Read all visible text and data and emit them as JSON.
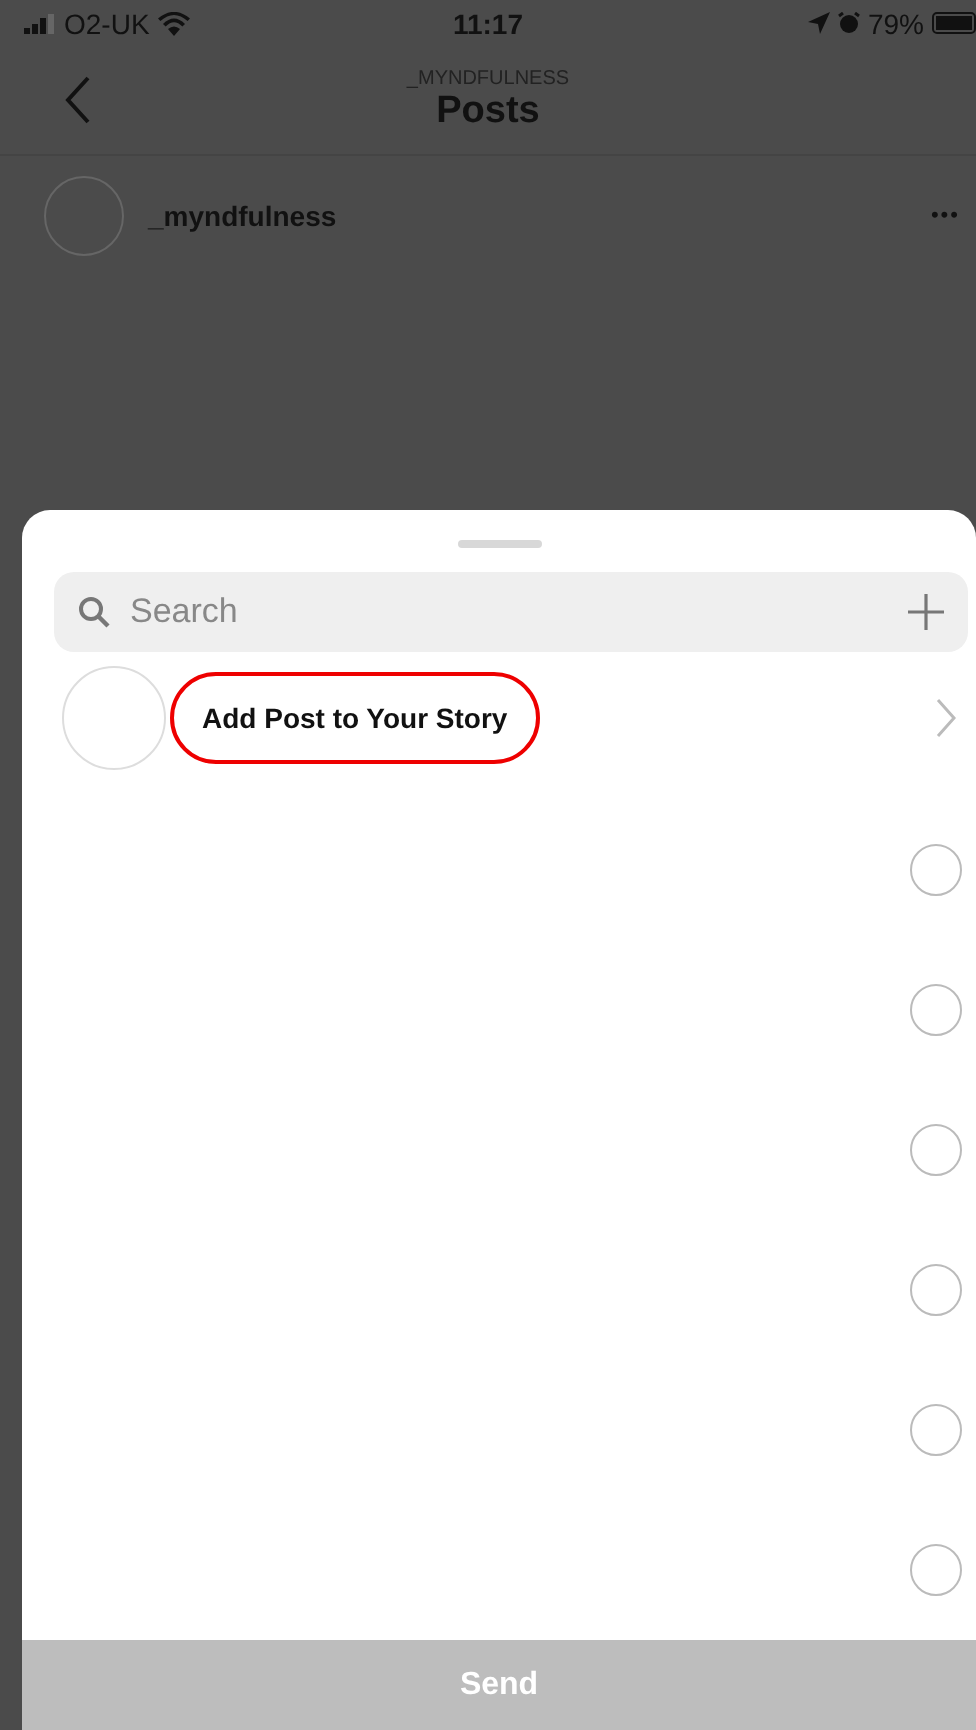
{
  "status_bar": {
    "carrier": "O2-UK",
    "time": "11:17",
    "battery": "79%"
  },
  "nav": {
    "subtitle": "_MYNDFULNESS",
    "title": "Posts"
  },
  "post_header": {
    "username": "_myndfulness",
    "more": "•••"
  },
  "share_sheet": {
    "search": {
      "placeholder": "Search"
    },
    "story_row": {
      "label": "Add Post to Your Story",
      "highlighted": true
    },
    "recipients": [
      {
        "selected": false
      },
      {
        "selected": false
      },
      {
        "selected": false
      },
      {
        "selected": false
      },
      {
        "selected": false
      },
      {
        "selected": false
      }
    ],
    "send_button": {
      "label": "Send",
      "disabled": true
    }
  }
}
